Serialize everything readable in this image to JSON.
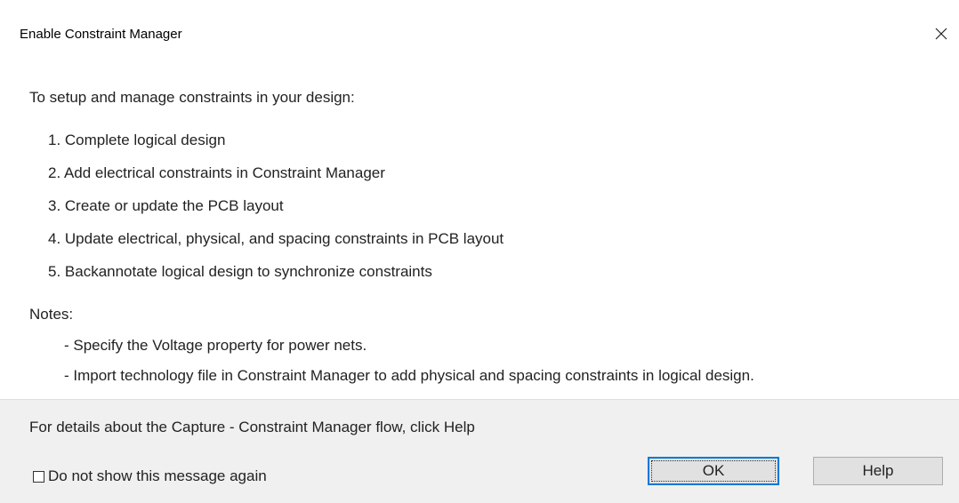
{
  "window": {
    "title": "Enable Constraint Manager",
    "close_icon": "close-icon"
  },
  "content": {
    "intro": "To setup and manage constraints in your design:",
    "steps": [
      "1. Complete logical design",
      "2. Add electrical constraints in Constraint Manager",
      "3. Create or update the PCB layout",
      "4. Update electrical, physical, and spacing constraints in PCB layout",
      "5. Backannotate logical design to synchronize constraints"
    ],
    "notes_label": "Notes:",
    "notes": [
      "- Specify the Voltage property for power nets.",
      "- Import technology file in Constraint Manager to add physical and spacing constraints in logical design."
    ]
  },
  "footer": {
    "details": "For details about the Capture - Constraint Manager flow, click Help",
    "checkbox_label": "Do not show this message again",
    "checkbox_checked": false,
    "ok_label": "OK",
    "help_label": "Help"
  },
  "colors": {
    "footer_bg": "#f0f0f0",
    "button_bg": "#e1e1e1",
    "focus_border": "#0078d7"
  }
}
